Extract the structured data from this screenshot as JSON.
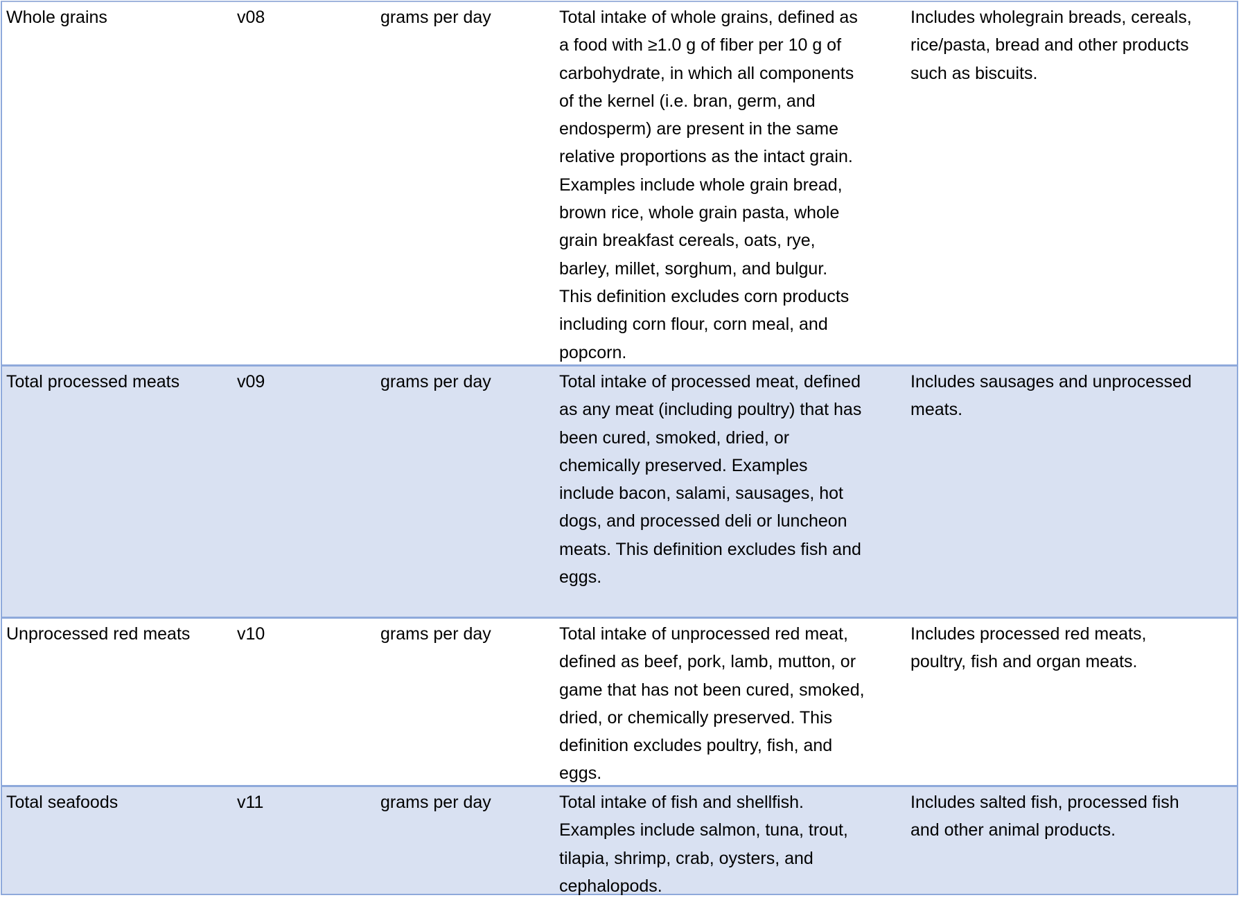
{
  "rows": [
    {
      "name": "Whole grains",
      "code": "v08",
      "unit": "grams per day",
      "definition": "Total intake of whole grains, defined as\na food with ≥1.0 g of fiber per 10 g of\ncarbohydrate, in which all components\nof the kernel (i.e. bran, germ, and\nendosperm) are present in the same\nrelative proportions as the intact grain.\nExamples include whole grain bread,\nbrown rice, whole grain pasta, whole\ngrain breakfast cereals, oats, rye,\nbarley, millet, sorghum, and bulgur.\nThis definition excludes corn products\nincluding corn flour, corn meal, and\npopcorn.",
      "notes": "Includes wholegrain breads, cereals,\nrice/pasta, bread and other products\nsuch as biscuits."
    },
    {
      "name": "Total processed meats",
      "code": "v09",
      "unit": "grams per day",
      "definition": "Total intake of processed meat, defined\nas any meat (including poultry) that has\nbeen cured, smoked, dried, or\nchemically preserved.  Examples\ninclude bacon, salami, sausages, hot\ndogs, and processed deli or luncheon\nmeats. This definition excludes fish and\neggs.",
      "notes": "Includes sausages and unprocessed\nmeats."
    },
    {
      "name": "Unprocessed red meats",
      "code": "v10",
      "unit": "grams per day",
      "definition": "Total intake of unprocessed red meat,\ndefined as beef, pork, lamb, mutton, or\ngame that has not been cured, smoked,\ndried, or chemically preserved. This\ndefinition excludes poultry, fish, and\neggs.",
      "notes": "Includes processed red meats,\npoultry, fish and organ meats."
    },
    {
      "name": "Total seafoods",
      "code": "v11",
      "unit": "grams per day",
      "definition": "Total intake of fish and shellfish.\nExamples include salmon, tuna, trout,\ntilapia, shrimp, crab, oysters, and\ncephalopods.",
      "notes": "Includes salted fish, processed fish\nand other animal products."
    }
  ],
  "colors": {
    "alt_row": "#d9e1f2",
    "border": "#8ea9db"
  }
}
